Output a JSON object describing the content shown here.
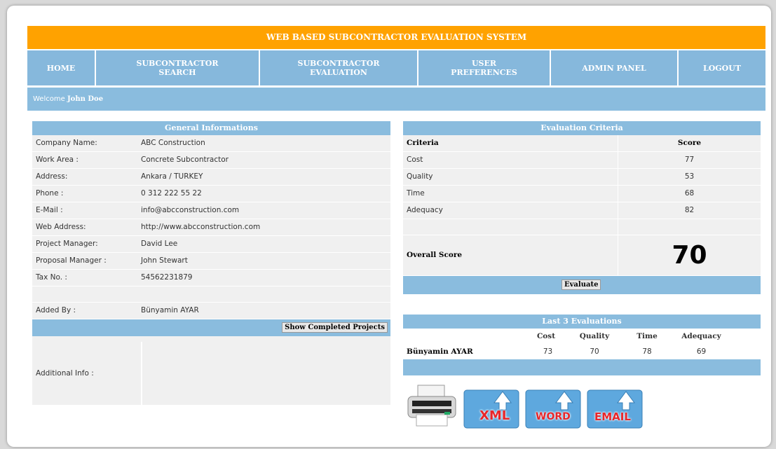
{
  "app": {
    "title": "WEB BASED SUBCONTRACTOR EVALUATION SYSTEM"
  },
  "nav": [
    {
      "line1": "HOME",
      "line2": ""
    },
    {
      "line1": "SUBCONTRACTOR",
      "line2": "SEARCH"
    },
    {
      "line1": "SUBCONTRACTOR",
      "line2": "EVALUATION"
    },
    {
      "line1": "USER",
      "line2": "PREFERENCES"
    },
    {
      "line1": "ADMIN PANEL",
      "line2": ""
    },
    {
      "line1": "LOGOUT",
      "line2": ""
    }
  ],
  "welcome": {
    "prefix": "Welcome",
    "user": "John Doe"
  },
  "general": {
    "title": "General Informations",
    "rows": [
      {
        "label": "Company Name:",
        "value": "ABC Construction"
      },
      {
        "label": "Work Area :",
        "value": "Concrete Subcontractor"
      },
      {
        "label": "Address:",
        "value": "Ankara / TURKEY"
      },
      {
        "label": "Phone :",
        "value": "0 312 222 55 22"
      },
      {
        "label": "E-Mail :",
        "value": "info@abcconstruction.com"
      },
      {
        "label": "Web Address:",
        "value": "http://www.abcconstruction.com"
      },
      {
        "label": "Project Manager:",
        "value": "David Lee"
      },
      {
        "label": "Proposal Manager :",
        "value": "John Stewart"
      },
      {
        "label": "Tax No. :",
        "value": "54562231879"
      }
    ],
    "added_by_label": "Added By :",
    "added_by_value": "Bünyamin AYAR",
    "show_completed_button": "Show Completed Projects",
    "additional_info_label": "Additional Info :",
    "additional_info_value": ""
  },
  "criteria": {
    "title": "Evaluation Criteria",
    "col_criteria": "Criteria",
    "col_score": "Score",
    "rows": [
      {
        "name": "Cost",
        "score": "77"
      },
      {
        "name": "Quality",
        "score": "53"
      },
      {
        "name": "Time",
        "score": "68"
      },
      {
        "name": "Adequacy",
        "score": "82"
      }
    ],
    "overall_label": "Overall Score",
    "overall_value": "70",
    "evaluate_button": "Evaluate"
  },
  "last_evals": {
    "title": "Last 3 Evaluations",
    "headers": [
      "Cost",
      "Quality",
      "Time",
      "Adequacy"
    ],
    "rows": [
      {
        "name": "Bünyamin AYAR",
        "cost": "73",
        "quality": "70",
        "time": "78",
        "adequacy": "69"
      }
    ]
  },
  "exports": {
    "print_icon": "printer-icon",
    "xml_label": "XML",
    "word_label": "WORD",
    "email_label": "EMAIL"
  },
  "colors": {
    "header": "#ffa200",
    "nav": "#86b8dc",
    "panel_header": "#8abcde",
    "export_red": "#e8262a"
  }
}
